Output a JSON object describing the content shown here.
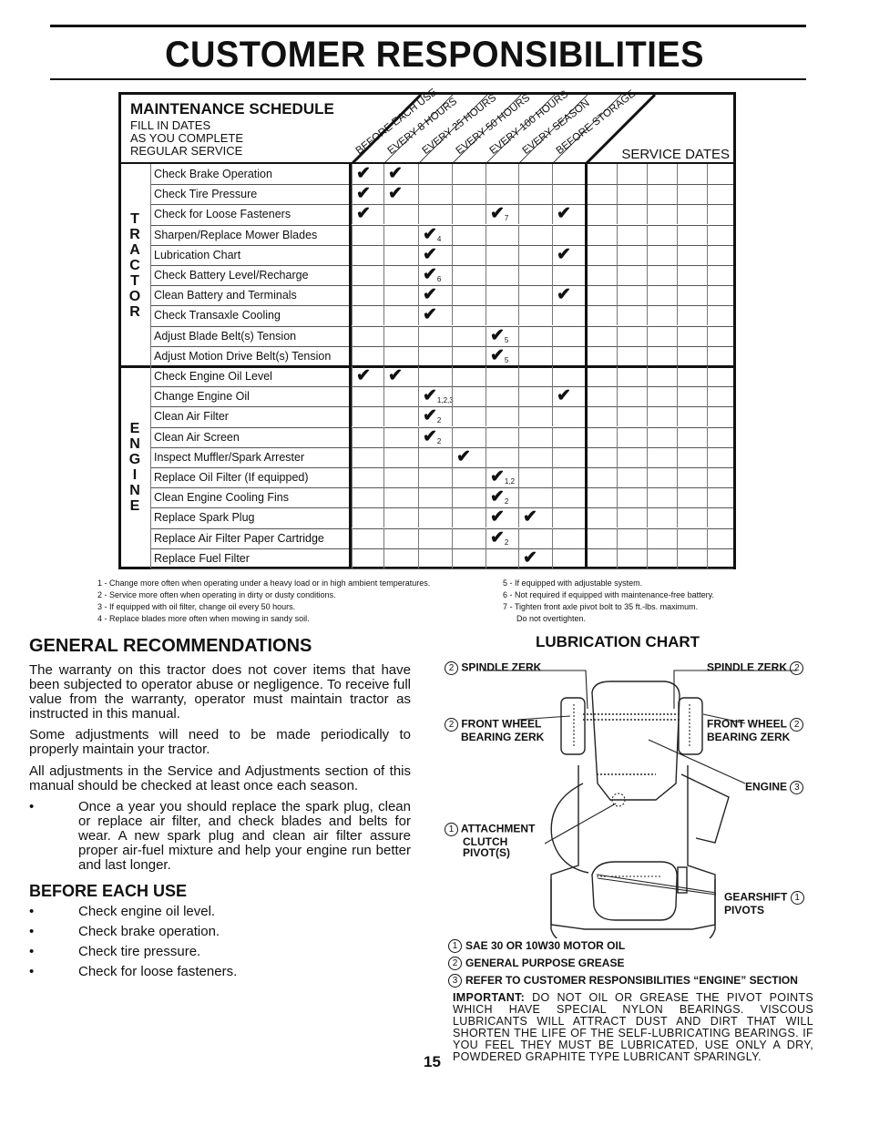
{
  "page": {
    "title": "CUSTOMER RESPONSIBILITIES",
    "page_number": "15"
  },
  "maintenance_schedule": {
    "title": "MAINTENANCE SCHEDULE",
    "subtitle_lines": [
      "FILL IN DATES",
      "AS YOU COMPLETE",
      "REGULAR SERVICE"
    ],
    "interval_headers": [
      "BEFORE EACH USE",
      "EVERY 8 HOURS",
      "EVERY 25 HOURS",
      "EVERY 50 HOURS",
      "EVERY 100 HOURS",
      "EVERY SEASON",
      "BEFORE STORAGE"
    ],
    "service_dates_label": "SERVICE DATES",
    "service_date_columns": 5,
    "check_glyph": "✔",
    "sections": [
      {
        "name": "TRACTOR",
        "letters": [
          "T",
          "R",
          "A",
          "C",
          "T",
          "O",
          "R"
        ],
        "rows": [
          {
            "task": "Check Brake Operation",
            "marks": [
              {
                "col": 0,
                "note": ""
              },
              {
                "col": 1,
                "note": ""
              }
            ]
          },
          {
            "task": "Check Tire Pressure",
            "marks": [
              {
                "col": 0,
                "note": ""
              },
              {
                "col": 1,
                "note": ""
              }
            ]
          },
          {
            "task": "Check for Loose Fasteners",
            "marks": [
              {
                "col": 0,
                "note": ""
              },
              {
                "col": 4,
                "note": "7"
              },
              {
                "col": 6,
                "note": ""
              }
            ]
          },
          {
            "task": "Sharpen/Replace Mower Blades",
            "marks": [
              {
                "col": 2,
                "note": "4"
              }
            ]
          },
          {
            "task": "Lubrication Chart",
            "marks": [
              {
                "col": 2,
                "note": ""
              },
              {
                "col": 6,
                "note": ""
              }
            ]
          },
          {
            "task": "Check Battery Level/Recharge",
            "marks": [
              {
                "col": 2,
                "note": "6"
              }
            ]
          },
          {
            "task": "Clean Battery and Terminals",
            "marks": [
              {
                "col": 2,
                "note": ""
              },
              {
                "col": 6,
                "note": ""
              }
            ]
          },
          {
            "task": "Check Transaxle Cooling",
            "marks": [
              {
                "col": 2,
                "note": ""
              }
            ]
          },
          {
            "task": "Adjust Blade Belt(s) Tension",
            "marks": [
              {
                "col": 4,
                "note": "5"
              }
            ]
          },
          {
            "task": "Adjust Motion Drive Belt(s) Tension",
            "marks": [
              {
                "col": 4,
                "note": "5"
              }
            ]
          }
        ]
      },
      {
        "name": "ENGINE",
        "letters": [
          "E",
          "N",
          "G",
          "I",
          "N",
          "E"
        ],
        "rows": [
          {
            "task": "Check Engine Oil Level",
            "marks": [
              {
                "col": 0,
                "note": ""
              },
              {
                "col": 1,
                "note": ""
              }
            ]
          },
          {
            "task": "Change Engine Oil",
            "marks": [
              {
                "col": 2,
                "note": "1,2,3"
              },
              {
                "col": 6,
                "note": ""
              }
            ]
          },
          {
            "task": "Clean Air Filter",
            "marks": [
              {
                "col": 2,
                "note": "2"
              }
            ]
          },
          {
            "task": "Clean Air Screen",
            "marks": [
              {
                "col": 2,
                "note": "2"
              }
            ]
          },
          {
            "task": "Inspect Muffler/Spark Arrester",
            "marks": [
              {
                "col": 3,
                "note": ""
              }
            ]
          },
          {
            "task": "Replace Oil Filter (If equipped)",
            "marks": [
              {
                "col": 4,
                "note": "1,2"
              }
            ]
          },
          {
            "task": "Clean Engine Cooling Fins",
            "marks": [
              {
                "col": 4,
                "note": "2"
              }
            ]
          },
          {
            "task": "Replace Spark Plug",
            "marks": [
              {
                "col": 4,
                "note": ""
              },
              {
                "col": 5,
                "note": ""
              }
            ]
          },
          {
            "task": "Replace Air Filter Paper Cartridge",
            "marks": [
              {
                "col": 4,
                "note": "2"
              }
            ]
          },
          {
            "task": "Replace Fuel Filter",
            "marks": [
              {
                "col": 5,
                "note": ""
              }
            ]
          }
        ]
      }
    ],
    "footnotes_left": [
      "1 - Change more often when operating under a heavy load or in high ambient temperatures.",
      "2 - Service more often when operating in dirty or dusty conditions.",
      "3 - If equipped with oil filter, change oil every 50 hours.",
      "4 - Replace blades more often when mowing in sandy soil."
    ],
    "footnotes_right": [
      "5 - If equipped with adjustable system.",
      "6 - Not required if equipped with maintenance-free battery.",
      "7 - Tighten front axle pivot bolt to 35 ft.-lbs. maximum.",
      "Do not overtighten."
    ]
  },
  "general_recommendations": {
    "heading": "GENERAL RECOMMENDATIONS",
    "paragraphs": [
      "The warranty on this tractor does not cover items that have been subjected to operator abuse or negligence.  To receive full value from the warranty, operator must maintain tractor as instructed in this manual.",
      "Some adjustments will need to be made periodically to properly maintain your tractor.",
      "All adjustments in the Service and Adjustments section of this manual should be checked at least once each season."
    ],
    "bullet": "Once a year you should replace the spark plug, clean or replace air filter, and check blades and belts for wear.  A new spark plug and clean air filter assure proper air-fuel mixture and help your engine run better and last longer."
  },
  "before_each_use": {
    "heading": "BEFORE EACH USE",
    "items": [
      "Check engine oil level.",
      "Check brake operation.",
      "Check tire pressure.",
      "Check for loose fasteners."
    ]
  },
  "lubrication_chart": {
    "heading": "LUBRICATION CHART",
    "labels": {
      "spindle_left": {
        "num": "2",
        "text": "SPINDLE ZERK"
      },
      "spindle_right": {
        "num": "2",
        "text": "SPINDLE ZERK"
      },
      "wheel_left": {
        "num": "2",
        "line1": "FRONT WHEEL",
        "line2": "BEARING ZERK"
      },
      "wheel_right": {
        "num": "2",
        "line1": "FRONT WHEEL",
        "line2": "BEARING ZERK"
      },
      "engine": {
        "num": "3",
        "text": "ENGINE"
      },
      "attachment": {
        "num": "1",
        "line1": "ATTACHMENT",
        "line2": "CLUTCH",
        "line3": "PIVOT(S)"
      },
      "gearshift": {
        "num": "1",
        "line1": "GEARSHIFT",
        "line2": "PIVOTS"
      }
    },
    "legend": [
      {
        "num": "1",
        "text": "SAE 30 OR 10W30 MOTOR OIL"
      },
      {
        "num": "2",
        "text": "GENERAL PURPOSE GREASE"
      },
      {
        "num": "3",
        "text": "REFER TO CUSTOMER RESPONSIBILITIES “ENGINE” SECTION"
      }
    ],
    "important_label": "IMPORTANT:",
    "important_text": "DO NOT OIL OR GREASE THE PIVOT POINTS WHICH HAVE SPECIAL NYLON BEARINGS.  VISCOUS LUBRICANTS WILL ATTRACT DUST AND DIRT THAT WILL SHORTEN THE LIFE OF THE SELF-LUBRICATING BEARINGS.  IF YOU FEEL THEY MUST BE LUBRICATED, USE ONLY A DRY, POWDERED GRAPHITE TYPE LUBRICANT SPARINGLY."
  }
}
